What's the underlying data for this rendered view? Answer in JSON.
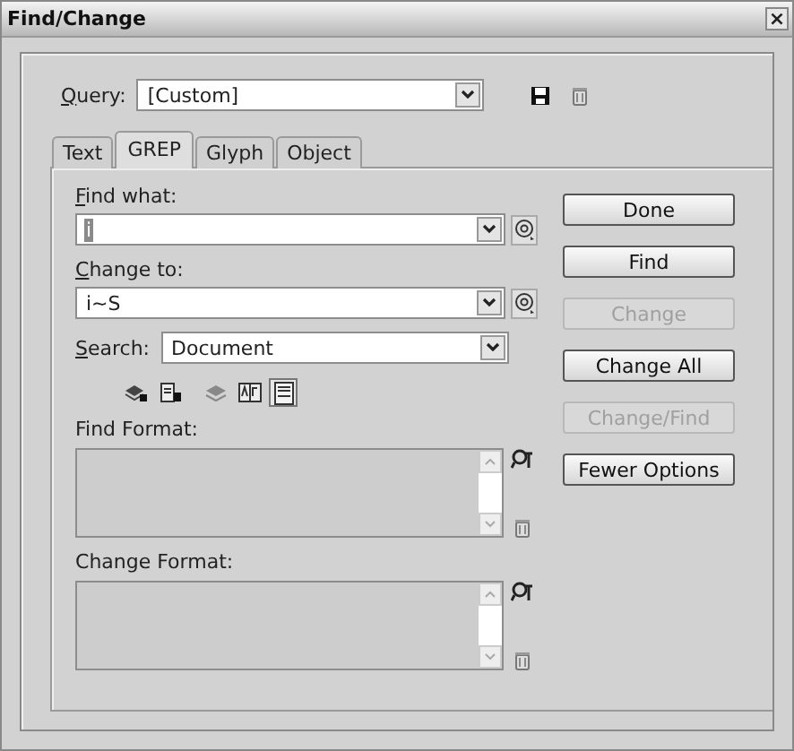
{
  "window": {
    "title": "Find/Change",
    "close": "×"
  },
  "query": {
    "label": "Query:",
    "value": "[Custom]"
  },
  "tabs": [
    {
      "label": "Text",
      "selected": false
    },
    {
      "label": "GREP",
      "selected": true
    },
    {
      "label": "Glyph",
      "selected": false
    },
    {
      "label": "Object",
      "selected": false
    }
  ],
  "find_what": {
    "label": "Find what:",
    "value": "i",
    "highlighted": true
  },
  "change_to": {
    "label": "Change to:",
    "value": "i~S",
    "highlighted": false
  },
  "search": {
    "label": "Search:",
    "value": "Document"
  },
  "options": [
    {
      "kind": "layers",
      "on": false
    },
    {
      "kind": "locked",
      "on": false
    },
    {
      "kind": "hidden",
      "on": false
    },
    {
      "kind": "case",
      "on": false
    },
    {
      "kind": "whole",
      "on": true
    }
  ],
  "find_format": {
    "label": "Find Format:"
  },
  "change_format": {
    "label": "Change Format:"
  },
  "buttons": [
    {
      "label": "Done",
      "disabled": false
    },
    {
      "label": "Find",
      "disabled": false
    },
    {
      "label": "Change",
      "disabled": true
    },
    {
      "label": "Change All",
      "disabled": false
    },
    {
      "label": "Change/Find",
      "disabled": true
    },
    {
      "label": "Fewer Options",
      "disabled": false
    }
  ]
}
